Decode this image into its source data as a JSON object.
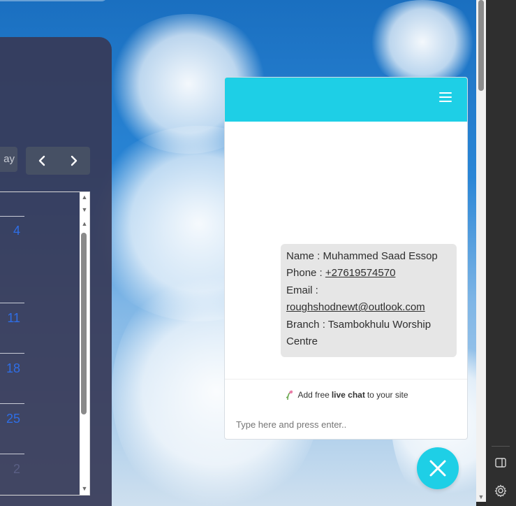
{
  "calendar": {
    "view_label": "ay",
    "prev_icon": "chevron-left-icon",
    "next_icon": "chevron-right-icon",
    "days": [
      "4",
      "11",
      "18",
      "25",
      "2"
    ]
  },
  "chat": {
    "header_icon": "hamburger-menu-icon",
    "message": {
      "name_line": "Name : Muhammed Saad Essop",
      "phone_prefix": "Phone : ",
      "phone": "+27619574570",
      "email_label": "Email :",
      "email": "roughshodnewt@outlook.com",
      "branch_line1": "Branch : Tsambokhulu Worship",
      "branch_line2": "Centre"
    },
    "promo": {
      "icon": "flower-icon",
      "prefix": "Add free",
      "bold": "live chat",
      "suffix": "to your site"
    },
    "input_placeholder": "Type here and press enter..",
    "close_icon": "close-icon",
    "accent": "#1ecfe6"
  },
  "rail": {
    "sidebar_icon": "sidebar-toggle-icon",
    "settings_icon": "gear-icon"
  }
}
